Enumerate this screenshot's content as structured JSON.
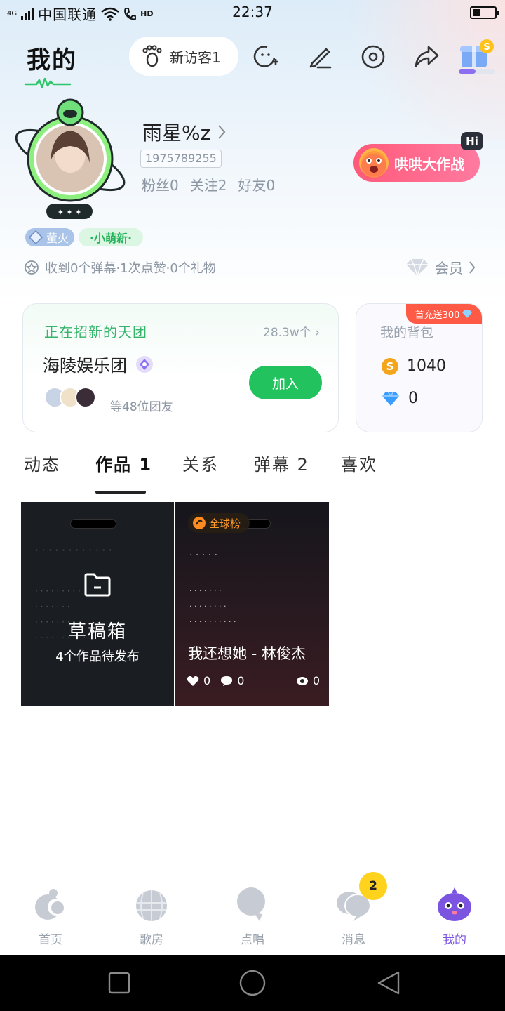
{
  "status": {
    "network_type": "4G",
    "carrier": "中国联通",
    "hd_label": "HD",
    "time": "22:37"
  },
  "header": {
    "title": "我的",
    "visitors_label": "新访客1",
    "icons": [
      "footprint-icon",
      "add-emoji-icon",
      "edit-icon",
      "settings-icon",
      "share-icon",
      "gift-box-icon"
    ]
  },
  "profile": {
    "username": "雨星%z",
    "user_id": "1975789255",
    "fans_label": "粉丝0",
    "following_label": "关注2",
    "friends_label": "好友0",
    "battle_label": "哄哄大作战",
    "hi_label": "Hi",
    "badge_firefly": "萤火",
    "badge_new": "·小萌新·",
    "received_summary": "收到0个弹幕·1次点赞·0个礼物",
    "vip_label": "会员"
  },
  "group_card": {
    "title": "正在招新的天团",
    "count": "28.3w个",
    "name": "海陵娱乐团",
    "join_label": "加入",
    "members_label": "等48位团友"
  },
  "bag_card": {
    "title": "我的背包",
    "promo": "首充送300",
    "coins": "1040",
    "diamonds": "0"
  },
  "tabs": [
    {
      "label": "动态",
      "active": false
    },
    {
      "label": "作品 1",
      "active": true
    },
    {
      "label": "关系",
      "active": false
    },
    {
      "label": "弹幕 2",
      "active": false
    },
    {
      "label": "喜欢",
      "active": false
    }
  ],
  "works": {
    "draft": {
      "title": "草稿箱",
      "subtitle": "4个作品待发布"
    },
    "song": {
      "rank_tag": "全球榜",
      "title": "我还想她 - 林俊杰",
      "likes": "0",
      "comments": "0",
      "views": "0"
    }
  },
  "bottom_nav": [
    {
      "label": "首页",
      "active": false
    },
    {
      "label": "歌房",
      "active": false
    },
    {
      "label": "点唱",
      "active": false
    },
    {
      "label": "消息",
      "active": false,
      "badge": "2"
    },
    {
      "label": "我的",
      "active": true
    }
  ],
  "colors": {
    "accent_green": "#22c35e",
    "nav_active": "#7b55e0",
    "badge_yellow": "#ffd21e",
    "battle_pink": "#ff5a7a"
  }
}
